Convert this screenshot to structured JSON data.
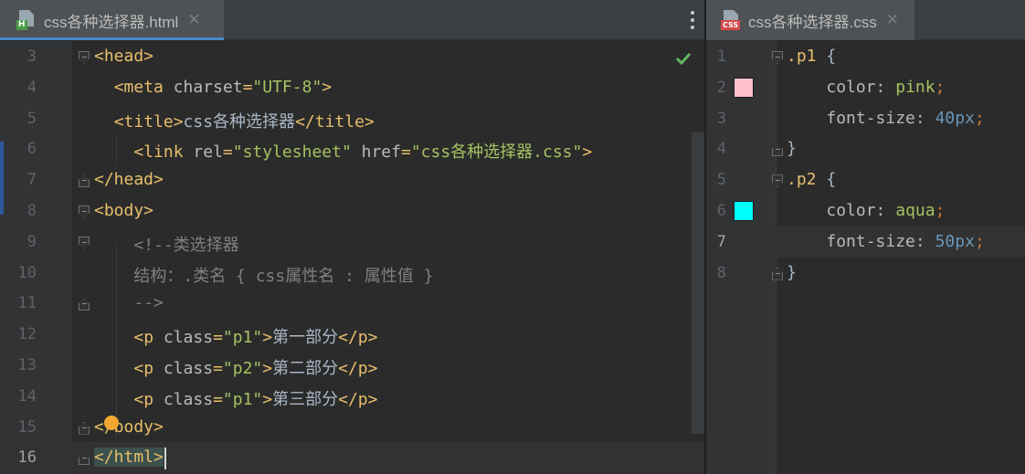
{
  "left_tab": {
    "label": "css各种选择器.html",
    "close": "✕",
    "file_badge": "H"
  },
  "right_tab": {
    "label": "css各种选择器.css",
    "close": "✕",
    "file_badge": "CSS"
  },
  "colors": {
    "accent": "#4a88c7",
    "pink_swatch": "#ffc0cb",
    "aqua_swatch": "#00ffff",
    "check": "#5fb85f"
  },
  "html_lines": [
    {
      "num": "3",
      "parts": [
        [
          "t-tag",
          "<head>"
        ]
      ]
    },
    {
      "num": "4",
      "parts": [
        [
          "t-txt",
          "  "
        ],
        [
          "t-tag",
          "<meta "
        ],
        [
          "t-attr",
          "charset"
        ],
        [
          "t-tag",
          "="
        ],
        [
          "t-val",
          "\"UTF-8\""
        ],
        [
          "t-tag",
          ">"
        ]
      ]
    },
    {
      "num": "5",
      "parts": [
        [
          "t-txt",
          "  "
        ],
        [
          "t-tag",
          "<title>"
        ],
        [
          "t-txt",
          "css各种选择器"
        ],
        [
          "t-tag",
          "</title>"
        ]
      ]
    },
    {
      "num": "6",
      "parts": [
        [
          "t-txt",
          "    "
        ],
        [
          "t-tag",
          "<link "
        ],
        [
          "t-attr",
          "rel"
        ],
        [
          "t-tag",
          "="
        ],
        [
          "t-val",
          "\"stylesheet\""
        ],
        [
          "t-attr",
          " href"
        ],
        [
          "t-tag",
          "="
        ],
        [
          "t-val",
          "\"css各种选择器.css\""
        ],
        [
          "t-tag",
          ">"
        ]
      ]
    },
    {
      "num": "7",
      "parts": [
        [
          "t-tag",
          "</head>"
        ]
      ]
    },
    {
      "num": "8",
      "parts": [
        [
          "t-tag",
          "<body>"
        ]
      ]
    },
    {
      "num": "9",
      "parts": [
        [
          "t-txt",
          "    "
        ],
        [
          "t-com",
          "<!--类选择器"
        ]
      ]
    },
    {
      "num": "10",
      "parts": [
        [
          "t-txt",
          "    "
        ],
        [
          "t-com",
          "结构：.类名 { css属性名 : 属性值 }"
        ]
      ]
    },
    {
      "num": "11",
      "parts": [
        [
          "t-txt",
          "    "
        ],
        [
          "t-com",
          "-->"
        ]
      ]
    },
    {
      "num": "12",
      "parts": [
        [
          "t-txt",
          "    "
        ],
        [
          "t-tag",
          "<p "
        ],
        [
          "t-attr",
          "class"
        ],
        [
          "t-tag",
          "="
        ],
        [
          "t-val",
          "\"p1\""
        ],
        [
          "t-tag",
          ">"
        ],
        [
          "t-txt",
          "第一部分"
        ],
        [
          "t-tag",
          "</p>"
        ]
      ]
    },
    {
      "num": "13",
      "parts": [
        [
          "t-txt",
          "    "
        ],
        [
          "t-tag",
          "<p "
        ],
        [
          "t-attr",
          "class"
        ],
        [
          "t-tag",
          "="
        ],
        [
          "t-val",
          "\"p2\""
        ],
        [
          "t-tag",
          ">"
        ],
        [
          "t-txt",
          "第二部分"
        ],
        [
          "t-tag",
          "</p>"
        ]
      ]
    },
    {
      "num": "14",
      "parts": [
        [
          "t-txt",
          "    "
        ],
        [
          "t-tag",
          "<p "
        ],
        [
          "t-attr",
          "class"
        ],
        [
          "t-tag",
          "="
        ],
        [
          "t-val",
          "\"p1\""
        ],
        [
          "t-tag",
          ">"
        ],
        [
          "t-txt",
          "第三部分"
        ],
        [
          "t-tag",
          "</p>"
        ]
      ]
    },
    {
      "num": "15",
      "parts": [
        [
          "t-tag",
          "</body>"
        ]
      ]
    },
    {
      "num": "16",
      "parts": [
        [
          "t-tag tag-highlight",
          "</html>"
        ]
      ]
    }
  ],
  "css_lines": [
    {
      "num": "1",
      "parts": [
        [
          "t-sel",
          ".p1 "
        ],
        [
          "t-txt",
          "{"
        ]
      ]
    },
    {
      "num": "2",
      "parts": [
        [
          "t-txt",
          "    "
        ],
        [
          "t-prop",
          "color"
        ],
        [
          "t-txt",
          ": "
        ],
        [
          "t-cval",
          "pink"
        ],
        [
          "t-punc",
          ";"
        ]
      ]
    },
    {
      "num": "3",
      "parts": [
        [
          "t-txt",
          "    "
        ],
        [
          "t-prop",
          "font-size"
        ],
        [
          "t-txt",
          ": "
        ],
        [
          "t-num",
          "40px"
        ],
        [
          "t-punc",
          ";"
        ]
      ]
    },
    {
      "num": "4",
      "parts": [
        [
          "t-txt",
          "}"
        ]
      ]
    },
    {
      "num": "5",
      "parts": [
        [
          "t-sel",
          ".p2 "
        ],
        [
          "t-txt",
          "{"
        ]
      ]
    },
    {
      "num": "6",
      "parts": [
        [
          "t-txt",
          "    "
        ],
        [
          "t-prop",
          "color"
        ],
        [
          "t-txt",
          ": "
        ],
        [
          "t-cval",
          "aqua"
        ],
        [
          "t-punc",
          ";"
        ]
      ]
    },
    {
      "num": "7",
      "parts": [
        [
          "t-txt",
          "    "
        ],
        [
          "t-prop",
          "font-size"
        ],
        [
          "t-txt",
          ": "
        ],
        [
          "t-num",
          "50px"
        ],
        [
          "t-punc",
          ";"
        ]
      ]
    },
    {
      "num": "8",
      "parts": [
        [
          "t-txt",
          "}"
        ]
      ]
    }
  ]
}
